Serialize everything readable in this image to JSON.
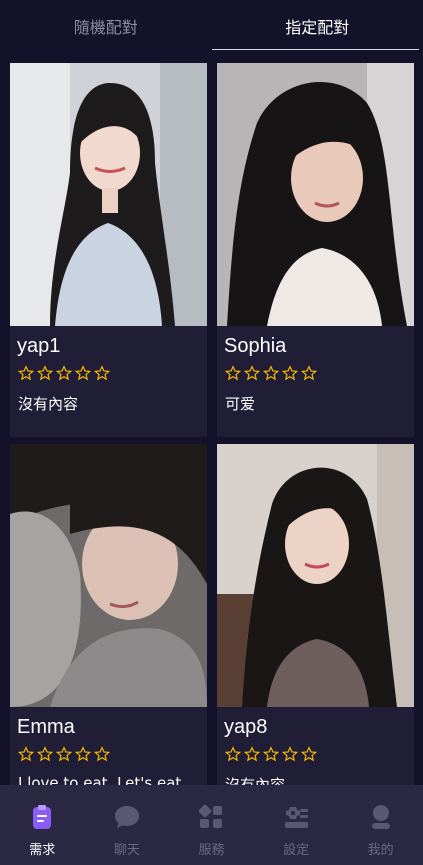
{
  "tabs": [
    {
      "label": "隨機配對",
      "active": false
    },
    {
      "label": "指定配對",
      "active": true
    }
  ],
  "cards": [
    {
      "name": "yap1",
      "rating": 0,
      "max_rating": 5,
      "description": "沒有內容",
      "photo_icon": "portrait-photo"
    },
    {
      "name": "Sophia",
      "rating": 0,
      "max_rating": 5,
      "description": "可爱",
      "photo_icon": "portrait-photo"
    },
    {
      "name": "Emma",
      "rating": 0,
      "max_rating": 5,
      "description": "I love to eat. Let's eat together",
      "photo_icon": "portrait-photo"
    },
    {
      "name": "yap8",
      "rating": 0,
      "max_rating": 5,
      "description": "沒有內容",
      "photo_icon": "portrait-photo"
    }
  ],
  "bottom_nav": [
    {
      "label": "需求",
      "icon": "clipboard-icon",
      "active": true
    },
    {
      "label": "聊天",
      "icon": "chat-icon",
      "active": false
    },
    {
      "label": "服務",
      "icon": "grid-icon",
      "active": false
    },
    {
      "label": "設定",
      "icon": "settings-icon",
      "active": false
    },
    {
      "label": "我的",
      "icon": "user-icon",
      "active": false
    }
  ],
  "colors": {
    "background": "#14122a",
    "card": "#201e36",
    "nav_bg": "#2a2843",
    "star": "#f5b800",
    "accent": "#8b5cf6"
  }
}
